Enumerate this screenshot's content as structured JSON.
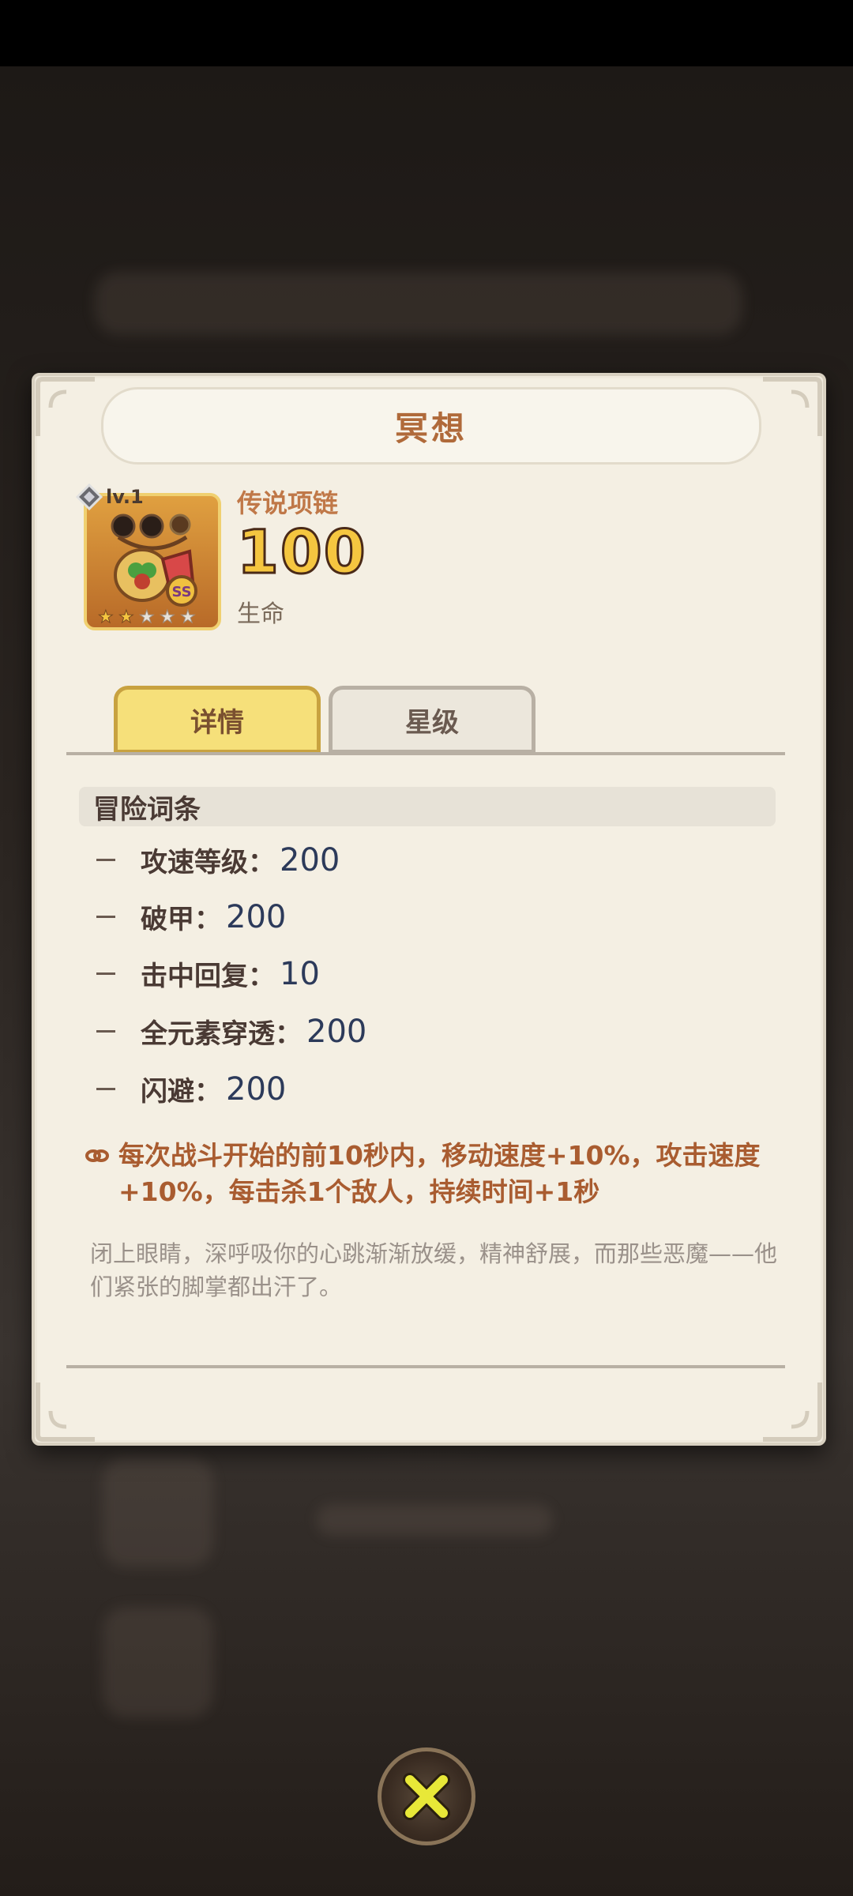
{
  "dialog": {
    "title": "冥想"
  },
  "item": {
    "level": "lv.1",
    "name": "传说项链",
    "value": "100",
    "stat_name": "生命",
    "stars_filled": 2,
    "stars_total": 5,
    "rank": "SS"
  },
  "tabs": [
    {
      "label": "详情",
      "active": true
    },
    {
      "label": "星级",
      "active": false
    }
  ],
  "section": {
    "title": "冒险词条",
    "stats": [
      {
        "label": "攻速等级：",
        "value": "200"
      },
      {
        "label": "破甲：",
        "value": "200"
      },
      {
        "label": "击中回复：",
        "value": "10"
      },
      {
        "label": "全元素穿透：",
        "value": "200"
      },
      {
        "label": "闪避：",
        "value": "200"
      }
    ]
  },
  "effect": {
    "text": "每次战斗开始的前10秒内，移动速度+10%，攻击速度+10%，每击杀1个敌人，持续时间+1秒"
  },
  "flavor": {
    "text": "闭上眼睛，深呼吸你的心跳渐渐放缓，精神舒展，而那些恶魔——他们紧张的脚掌都出汗了。"
  },
  "colors": {
    "accent": "#b06a3a",
    "effect": "#a95c30",
    "tab_active": "#f6e07a"
  }
}
